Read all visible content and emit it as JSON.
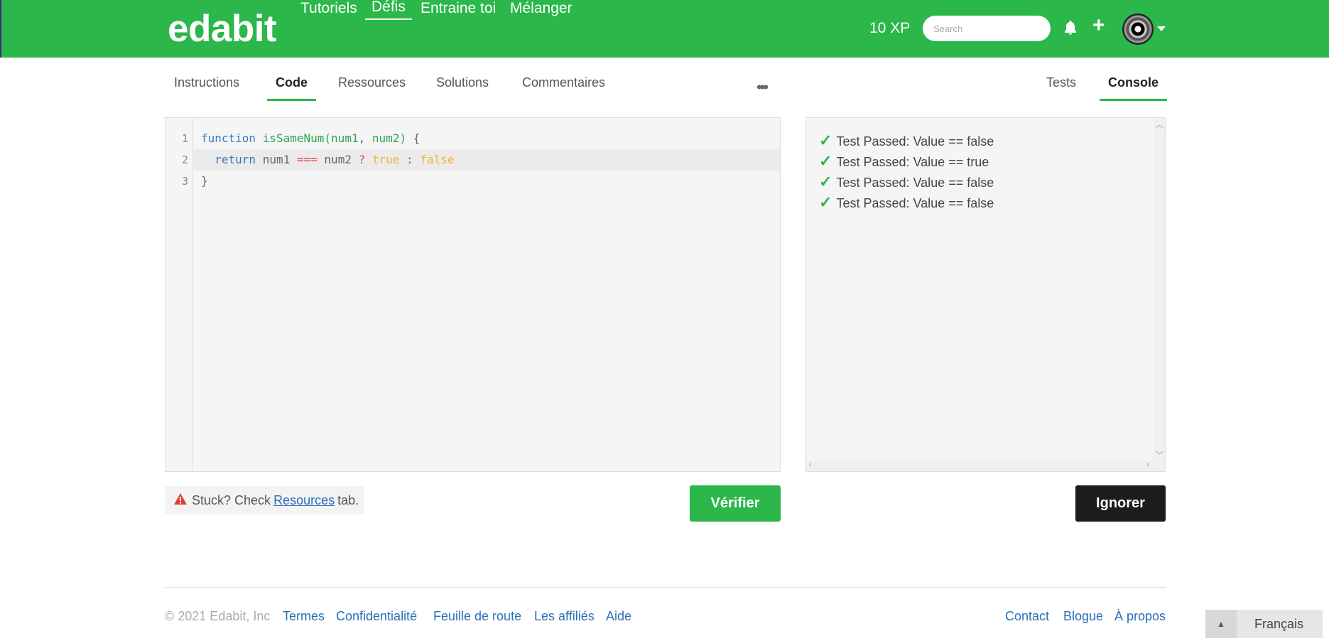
{
  "header": {
    "logo": "edabit",
    "nav": [
      "Tutoriels",
      "Défis",
      "Entraine toi",
      "Mélanger"
    ],
    "active_nav": "Défis",
    "xp": "10 XP",
    "search_placeholder": "Search",
    "icons": [
      "bell-icon",
      "plus-icon",
      "avatar",
      "caret-down-icon"
    ]
  },
  "tabs": {
    "left": [
      "Instructions",
      "Code",
      "Ressources",
      "Solutions",
      "Commentaires"
    ],
    "right": [
      "Tests",
      "Console"
    ],
    "active_left": "Code",
    "active_right": "Console",
    "more": "•••"
  },
  "editor": {
    "line_numbers": [
      "1",
      "2",
      "3"
    ],
    "lines": [
      "function isSameNum(num1, num2) {",
      "  return num1 === num2 ? true : false",
      "}"
    ]
  },
  "console": {
    "results": [
      "Test Passed: Value == false",
      "Test Passed: Value == true",
      "Test Passed: Value == false",
      "Test Passed: Value == false"
    ],
    "check_glyph": "✓"
  },
  "actions": {
    "stuck_prefix": "Stuck? Check",
    "stuck_link": "Resources",
    "stuck_suffix": "tab.",
    "verify_label": "Vérifier",
    "ignore_label": "Ignorer"
  },
  "footer": {
    "copyright": "© 2021 Edabit, Inc",
    "links_left": [
      "Termes",
      "Confidentialité",
      "Feuille de route",
      "Les affiliés",
      "Aide"
    ],
    "links_right": [
      "Contact",
      "Blogue",
      "À propos"
    ],
    "language": "Français"
  },
  "colors": {
    "brand_green": "#2bb74a",
    "dark_button": "#1c1c1c",
    "link_blue": "#2a6fb8"
  }
}
